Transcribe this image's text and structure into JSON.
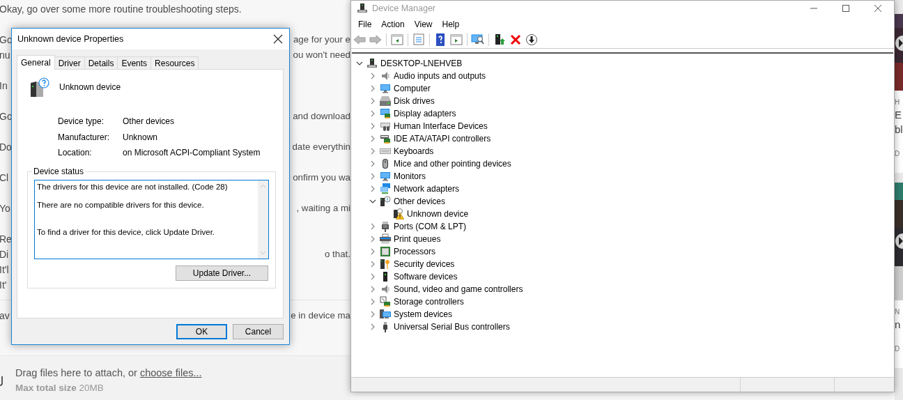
{
  "article": {
    "paragraphs": [
      {
        "lines": [
          {
            "left": "Okay, go over some more routine troubleshooting steps."
          }
        ]
      },
      {
        "lines": [
          {
            "left": "Go",
            "right": "age for your e"
          },
          {
            "left": "nu",
            "right": "ou won't need"
          }
        ]
      },
      {
        "lines": [
          {
            "left": "In"
          }
        ]
      },
      {
        "lines": [
          {
            "left": "Go",
            "right": "and download"
          }
        ]
      },
      {
        "lines": [
          {
            "left": "Do",
            "right": "date everythin"
          }
        ]
      },
      {
        "lines": [
          {
            "left": "Cl",
            "right": "onfirm you wa"
          }
        ]
      },
      {
        "lines": [
          {
            "left": "Yo",
            "right": ", waiting a mi"
          }
        ]
      },
      {
        "lines": [
          {
            "left": "Re"
          },
          {
            "left": "Di",
            "right": "o that."
          },
          {
            "left": "It'l"
          },
          {
            "left": "It'"
          }
        ]
      }
    ],
    "reply_line": {
      "left": "av",
      "right": "e in device ma"
    },
    "attach": {
      "prompt": "Drag files here to attach, or ",
      "link": "choose files...",
      "limit": "**Max total size** 20MB"
    }
  },
  "side_cards": [
    {
      "kicker": "H",
      "title_lines": [
        "E",
        "bl"
      ],
      "footer": "D"
    },
    {
      "kicker": "N",
      "title_lines": [
        "n"
      ],
      "footer": "D"
    }
  ],
  "device_manager": {
    "title": "Device Manager",
    "menu": [
      "File",
      "Action",
      "View",
      "Help"
    ],
    "tree": {
      "label": "DESKTOP-LNEHVEB",
      "expanded": true,
      "children": [
        {
          "label": "Audio inputs and outputs",
          "expanded": false
        },
        {
          "label": "Computer",
          "expanded": false
        },
        {
          "label": "Disk drives",
          "expanded": false
        },
        {
          "label": "Display adapters",
          "expanded": false
        },
        {
          "label": "Human Interface Devices",
          "expanded": false
        },
        {
          "label": "IDE ATA/ATAPI controllers",
          "expanded": false
        },
        {
          "label": "Keyboards",
          "expanded": false
        },
        {
          "label": "Mice and other pointing devices",
          "expanded": false
        },
        {
          "label": "Monitors",
          "expanded": false
        },
        {
          "label": "Network adapters",
          "expanded": false
        },
        {
          "label": "Other devices",
          "expanded": true,
          "children": [
            {
              "label": "Unknown device"
            }
          ]
        },
        {
          "label": "Ports (COM & LPT)",
          "expanded": false
        },
        {
          "label": "Print queues",
          "expanded": false
        },
        {
          "label": "Processors",
          "expanded": false
        },
        {
          "label": "Security devices",
          "expanded": false
        },
        {
          "label": "Software devices",
          "expanded": false
        },
        {
          "label": "Sound, video and game controllers",
          "expanded": false
        },
        {
          "label": "Storage controllers",
          "expanded": false
        },
        {
          "label": "System devices",
          "expanded": false
        },
        {
          "label": "Universal Serial Bus controllers",
          "expanded": false
        }
      ]
    }
  },
  "dialog": {
    "title": "Unknown device Properties",
    "tabs": [
      {
        "label": "General",
        "selected": true
      },
      {
        "label": "Driver",
        "selected": false
      },
      {
        "label": "Details",
        "selected": false
      },
      {
        "label": "Events",
        "selected": false
      },
      {
        "label": "Resources",
        "selected": false
      }
    ],
    "device_name": "Unknown device",
    "properties": [
      {
        "label": "Device type:",
        "value": "Other devices"
      },
      {
        "label": "Manufacturer:",
        "value": "Unknown"
      },
      {
        "label": "Location:",
        "value": "on Microsoft ACPI-Compliant System"
      }
    ],
    "status_group": "Device status",
    "status_text": "The drivers for this device are not installed. (Code 28)\n\nThere are no compatible drivers for this device.\n\n\nTo find a driver for this device, click Update Driver.",
    "update_button": "Update Driver...",
    "buttons": [
      {
        "label": "OK",
        "default": true
      },
      {
        "label": "Cancel",
        "default": false
      }
    ]
  }
}
